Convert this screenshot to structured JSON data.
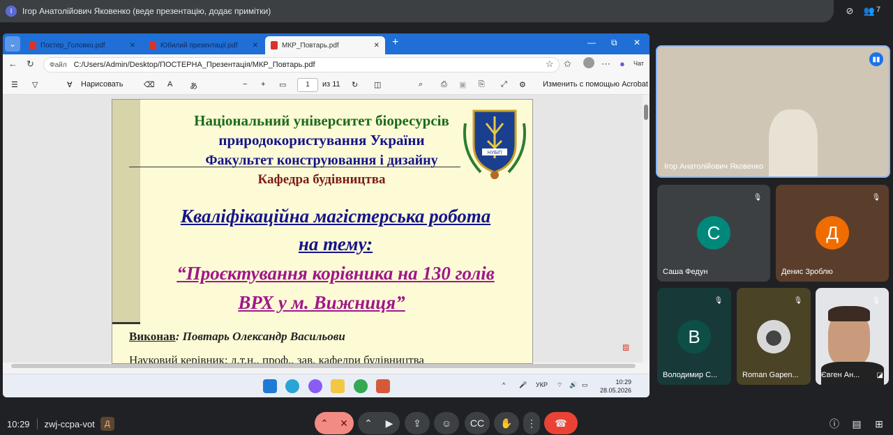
{
  "presenter_bar": {
    "initial": "І",
    "text": "Ігор Анатолійович Яковенко (веде презентацію, додає примітки)",
    "people_count": "7"
  },
  "browser": {
    "tabs": [
      {
        "label": "Постер_Головко.pdf",
        "active": false
      },
      {
        "label": "Юбилий презентації.pdf",
        "active": false
      },
      {
        "label": "МКР_Повтарь.pdf",
        "active": true
      }
    ],
    "new_tab": "+",
    "address_label": "Файл",
    "address": "C:/Users/Admin/Desktop/ПОСТЕРНА_Презентація/МКР_Повтарь.pdf",
    "copilot_label": "Чат"
  },
  "pdf_toolbar": {
    "draw_label": "Нарисовать",
    "page_current": "1",
    "page_total": "из 11",
    "edit_label": "Изменить с помощью Acrobat"
  },
  "slide": {
    "line1": "Національний університет біоресурсів",
    "line2": "природокористування України",
    "line3": "Факультет конструювання і дизайну",
    "line4": "Кафедра будівництва",
    "title1": "Кваліфікаційна магістерська робота",
    "title2": "на тему:",
    "topic1": "“Проєктування корівника на 130 голів",
    "topic2": "ВРХ у м. Вижниця”",
    "author_label": "Виконав",
    "author_name": ": Повтарь Олександр Васильови",
    "supervisor": "Науковий керівник: д.т.н., проф., зав. кафедри будівництва",
    "emblem_text": "НУБіП"
  },
  "taskbar": {
    "lang": "УКР",
    "time": "10:29",
    "date": "28.05.2026"
  },
  "participants": [
    {
      "name": "Ігор Анатолійович Яковенко",
      "type": "video"
    },
    {
      "name": "Саша Федун",
      "initial": "С",
      "color": "#00897b"
    },
    {
      "name": "Денис Зроблю",
      "initial": "Д",
      "color": "#ef6c00"
    },
    {
      "name": "Володимир С...",
      "initial": "В",
      "color": "#00695c"
    },
    {
      "name": "Roman Gapen...",
      "type": "photo"
    },
    {
      "name": "Євген Ан...",
      "type": "video"
    }
  ],
  "meeting": {
    "time": "10:29",
    "code": "zwj-ccpa-vot",
    "badge": "Д"
  }
}
